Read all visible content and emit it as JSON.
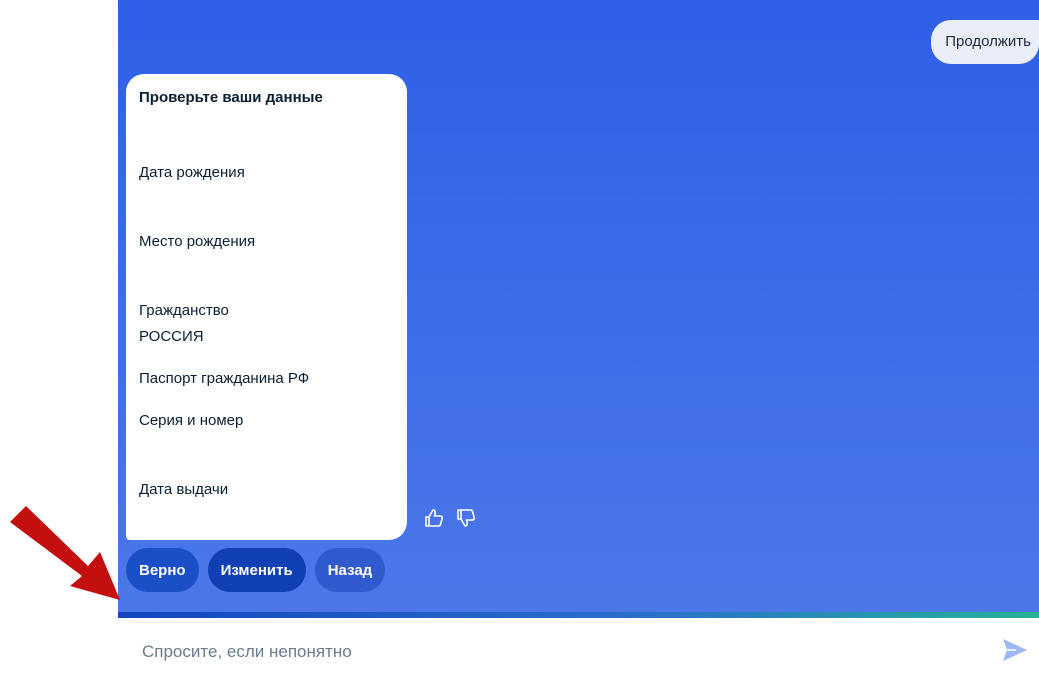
{
  "chat": {
    "continue_label": "Продолжить",
    "card": {
      "title": "Проверьте ваши данные",
      "fields": [
        {
          "label": "Дата рождения",
          "value": ""
        },
        {
          "label": "Место рождения",
          "value": ""
        },
        {
          "label": "Гражданство",
          "value": "РОССИЯ"
        },
        {
          "label": "Паспорт гражданина РФ",
          "value": ""
        },
        {
          "label": "Серия и номер",
          "value": ""
        },
        {
          "label": "Дата выдачи",
          "value": ""
        }
      ]
    },
    "reactions": {
      "like_icon": "thumbs-up-icon",
      "dislike_icon": "thumbs-down-icon"
    },
    "actions": {
      "correct_label": "Верно",
      "change_label": "Изменить",
      "back_label": "Назад"
    },
    "input": {
      "placeholder": "Спросите, если непонятно",
      "send_icon": "send-icon"
    }
  },
  "annotation": {
    "arrow_icon": "red-arrow-icon",
    "arrow_color": "#c40f0f"
  },
  "colors": {
    "chat_background": "#3e6cea",
    "button_primary": "#1b4fc8",
    "card_background": "#ffffff"
  }
}
